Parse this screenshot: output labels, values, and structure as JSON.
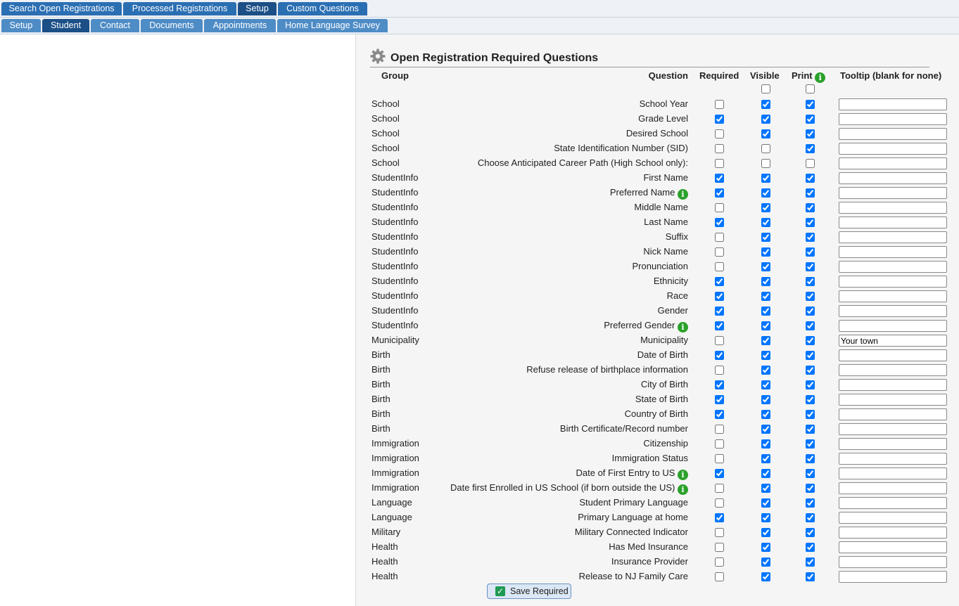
{
  "top_tabs": [
    {
      "label": "Search Open Registrations",
      "active": false
    },
    {
      "label": "Processed Registrations",
      "active": false
    },
    {
      "label": "Setup",
      "active": true
    },
    {
      "label": "Custom Questions",
      "active": false
    }
  ],
  "sub_tabs": [
    {
      "label": "Setup",
      "active": false
    },
    {
      "label": "Student",
      "active": true
    },
    {
      "label": "Contact",
      "active": false
    },
    {
      "label": "Documents",
      "active": false
    },
    {
      "label": "Appointments",
      "active": false
    },
    {
      "label": "Home Language Survey",
      "active": false
    }
  ],
  "panel": {
    "title": "Open Registration Required Questions",
    "icon": "gear-icon"
  },
  "columns": {
    "group": "Group",
    "question": "Question",
    "required": "Required",
    "visible": "Visible",
    "print": "Print",
    "tooltip": "Tooltip (blank for none)"
  },
  "header_toggles": {
    "visible_all": false,
    "print_all": false
  },
  "rows": [
    {
      "group": "School",
      "question": "School Year",
      "info": false,
      "required": false,
      "visible": true,
      "print": true,
      "tooltip": ""
    },
    {
      "group": "School",
      "question": "Grade Level",
      "info": false,
      "required": true,
      "visible": true,
      "print": true,
      "tooltip": ""
    },
    {
      "group": "School",
      "question": "Desired School",
      "info": false,
      "required": false,
      "visible": true,
      "print": true,
      "tooltip": ""
    },
    {
      "group": "School",
      "question": "State Identification Number (SID)",
      "info": false,
      "required": false,
      "visible": false,
      "print": true,
      "tooltip": ""
    },
    {
      "group": "School",
      "question": "Choose Anticipated Career Path (High School only):",
      "info": false,
      "required": false,
      "visible": false,
      "print": false,
      "tooltip": ""
    },
    {
      "group": "StudentInfo",
      "question": "First Name",
      "info": false,
      "required": true,
      "visible": true,
      "print": true,
      "tooltip": ""
    },
    {
      "group": "StudentInfo",
      "question": "Preferred Name",
      "info": true,
      "required": true,
      "visible": true,
      "print": true,
      "tooltip": ""
    },
    {
      "group": "StudentInfo",
      "question": "Middle Name",
      "info": false,
      "required": false,
      "visible": true,
      "print": true,
      "tooltip": ""
    },
    {
      "group": "StudentInfo",
      "question": "Last Name",
      "info": false,
      "required": true,
      "visible": true,
      "print": true,
      "tooltip": ""
    },
    {
      "group": "StudentInfo",
      "question": "Suffix",
      "info": false,
      "required": false,
      "visible": true,
      "print": true,
      "tooltip": ""
    },
    {
      "group": "StudentInfo",
      "question": "Nick Name",
      "info": false,
      "required": false,
      "visible": true,
      "print": true,
      "tooltip": ""
    },
    {
      "group": "StudentInfo",
      "question": "Pronunciation",
      "info": false,
      "required": false,
      "visible": true,
      "print": true,
      "tooltip": ""
    },
    {
      "group": "StudentInfo",
      "question": "Ethnicity",
      "info": false,
      "required": true,
      "visible": true,
      "print": true,
      "tooltip": ""
    },
    {
      "group": "StudentInfo",
      "question": "Race",
      "info": false,
      "required": true,
      "visible": true,
      "print": true,
      "tooltip": ""
    },
    {
      "group": "StudentInfo",
      "question": "Gender",
      "info": false,
      "required": true,
      "visible": true,
      "print": true,
      "tooltip": ""
    },
    {
      "group": "StudentInfo",
      "question": "Preferred Gender",
      "info": true,
      "required": true,
      "visible": true,
      "print": true,
      "tooltip": ""
    },
    {
      "group": "Municipality",
      "question": "Municipality",
      "info": false,
      "required": false,
      "visible": true,
      "print": true,
      "tooltip": "Your town"
    },
    {
      "group": "Birth",
      "question": "Date of Birth",
      "info": false,
      "required": true,
      "visible": true,
      "print": true,
      "tooltip": ""
    },
    {
      "group": "Birth",
      "question": "Refuse release of birthplace information",
      "info": false,
      "required": false,
      "visible": true,
      "print": true,
      "tooltip": ""
    },
    {
      "group": "Birth",
      "question": "City of Birth",
      "info": false,
      "required": true,
      "visible": true,
      "print": true,
      "tooltip": ""
    },
    {
      "group": "Birth",
      "question": "State of Birth",
      "info": false,
      "required": true,
      "visible": true,
      "print": true,
      "tooltip": ""
    },
    {
      "group": "Birth",
      "question": "Country of Birth",
      "info": false,
      "required": true,
      "visible": true,
      "print": true,
      "tooltip": ""
    },
    {
      "group": "Birth",
      "question": "Birth Certificate/Record number",
      "info": false,
      "required": false,
      "visible": true,
      "print": true,
      "tooltip": ""
    },
    {
      "group": "Immigration",
      "question": "Citizenship",
      "info": false,
      "required": false,
      "visible": true,
      "print": true,
      "tooltip": ""
    },
    {
      "group": "Immigration",
      "question": "Immigration Status",
      "info": false,
      "required": false,
      "visible": true,
      "print": true,
      "tooltip": ""
    },
    {
      "group": "Immigration",
      "question": "Date of First Entry to US",
      "info": true,
      "required": true,
      "visible": true,
      "print": true,
      "tooltip": ""
    },
    {
      "group": "Immigration",
      "question": "Date first Enrolled in US School (if born outside the US)",
      "info": true,
      "required": false,
      "visible": true,
      "print": true,
      "tooltip": ""
    },
    {
      "group": "Language",
      "question": "Student Primary Language",
      "info": false,
      "required": false,
      "visible": true,
      "print": true,
      "tooltip": ""
    },
    {
      "group": "Language",
      "question": "Primary Language at home",
      "info": false,
      "required": true,
      "visible": true,
      "print": true,
      "tooltip": ""
    },
    {
      "group": "Military",
      "question": "Military Connected Indicator",
      "info": false,
      "required": false,
      "visible": true,
      "print": true,
      "tooltip": ""
    },
    {
      "group": "Health",
      "question": "Has Med Insurance",
      "info": false,
      "required": false,
      "visible": true,
      "print": true,
      "tooltip": ""
    },
    {
      "group": "Health",
      "question": "Insurance Provider",
      "info": false,
      "required": false,
      "visible": true,
      "print": true,
      "tooltip": ""
    },
    {
      "group": "Health",
      "question": "Release to NJ Family Care",
      "info": false,
      "required": false,
      "visible": true,
      "print": true,
      "tooltip": ""
    }
  ],
  "save_button": {
    "label": "Save Required",
    "icon": "check-icon"
  },
  "colors": {
    "tab": "#2b6fb3",
    "tab_active": "#1b4f86",
    "subtab": "#4e8cc6",
    "info": "#2aa12a",
    "checkbox": "#0a66d6"
  }
}
